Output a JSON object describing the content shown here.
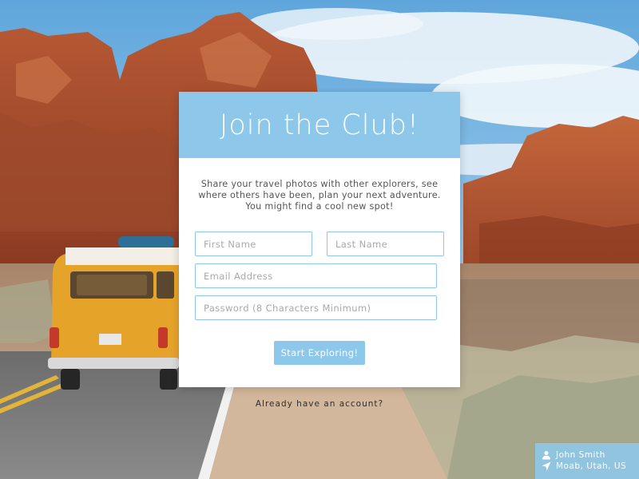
{
  "header": {
    "title": "Join the Club!"
  },
  "intro": {
    "text": "Share your travel photos with other explorers, see where others have been, plan your next adventure. You might find a cool new spot!"
  },
  "form": {
    "first_name": {
      "placeholder": "First Name",
      "value": ""
    },
    "last_name": {
      "placeholder": "Last Name",
      "value": ""
    },
    "email": {
      "placeholder": "Email Address",
      "value": ""
    },
    "password": {
      "placeholder": "Password (8 Characters Minimum)",
      "value": ""
    },
    "submit_label": "Start Exploring!"
  },
  "login_link": {
    "label": "Already have an account?"
  },
  "credit": {
    "name": "John Smith",
    "location": "Moab, Utah, US",
    "user_icon": "user-icon",
    "location_icon": "location-arrow-icon"
  },
  "colors": {
    "accent": "#8dc8ea",
    "card_background": "#ffffff",
    "text": "#555555"
  }
}
